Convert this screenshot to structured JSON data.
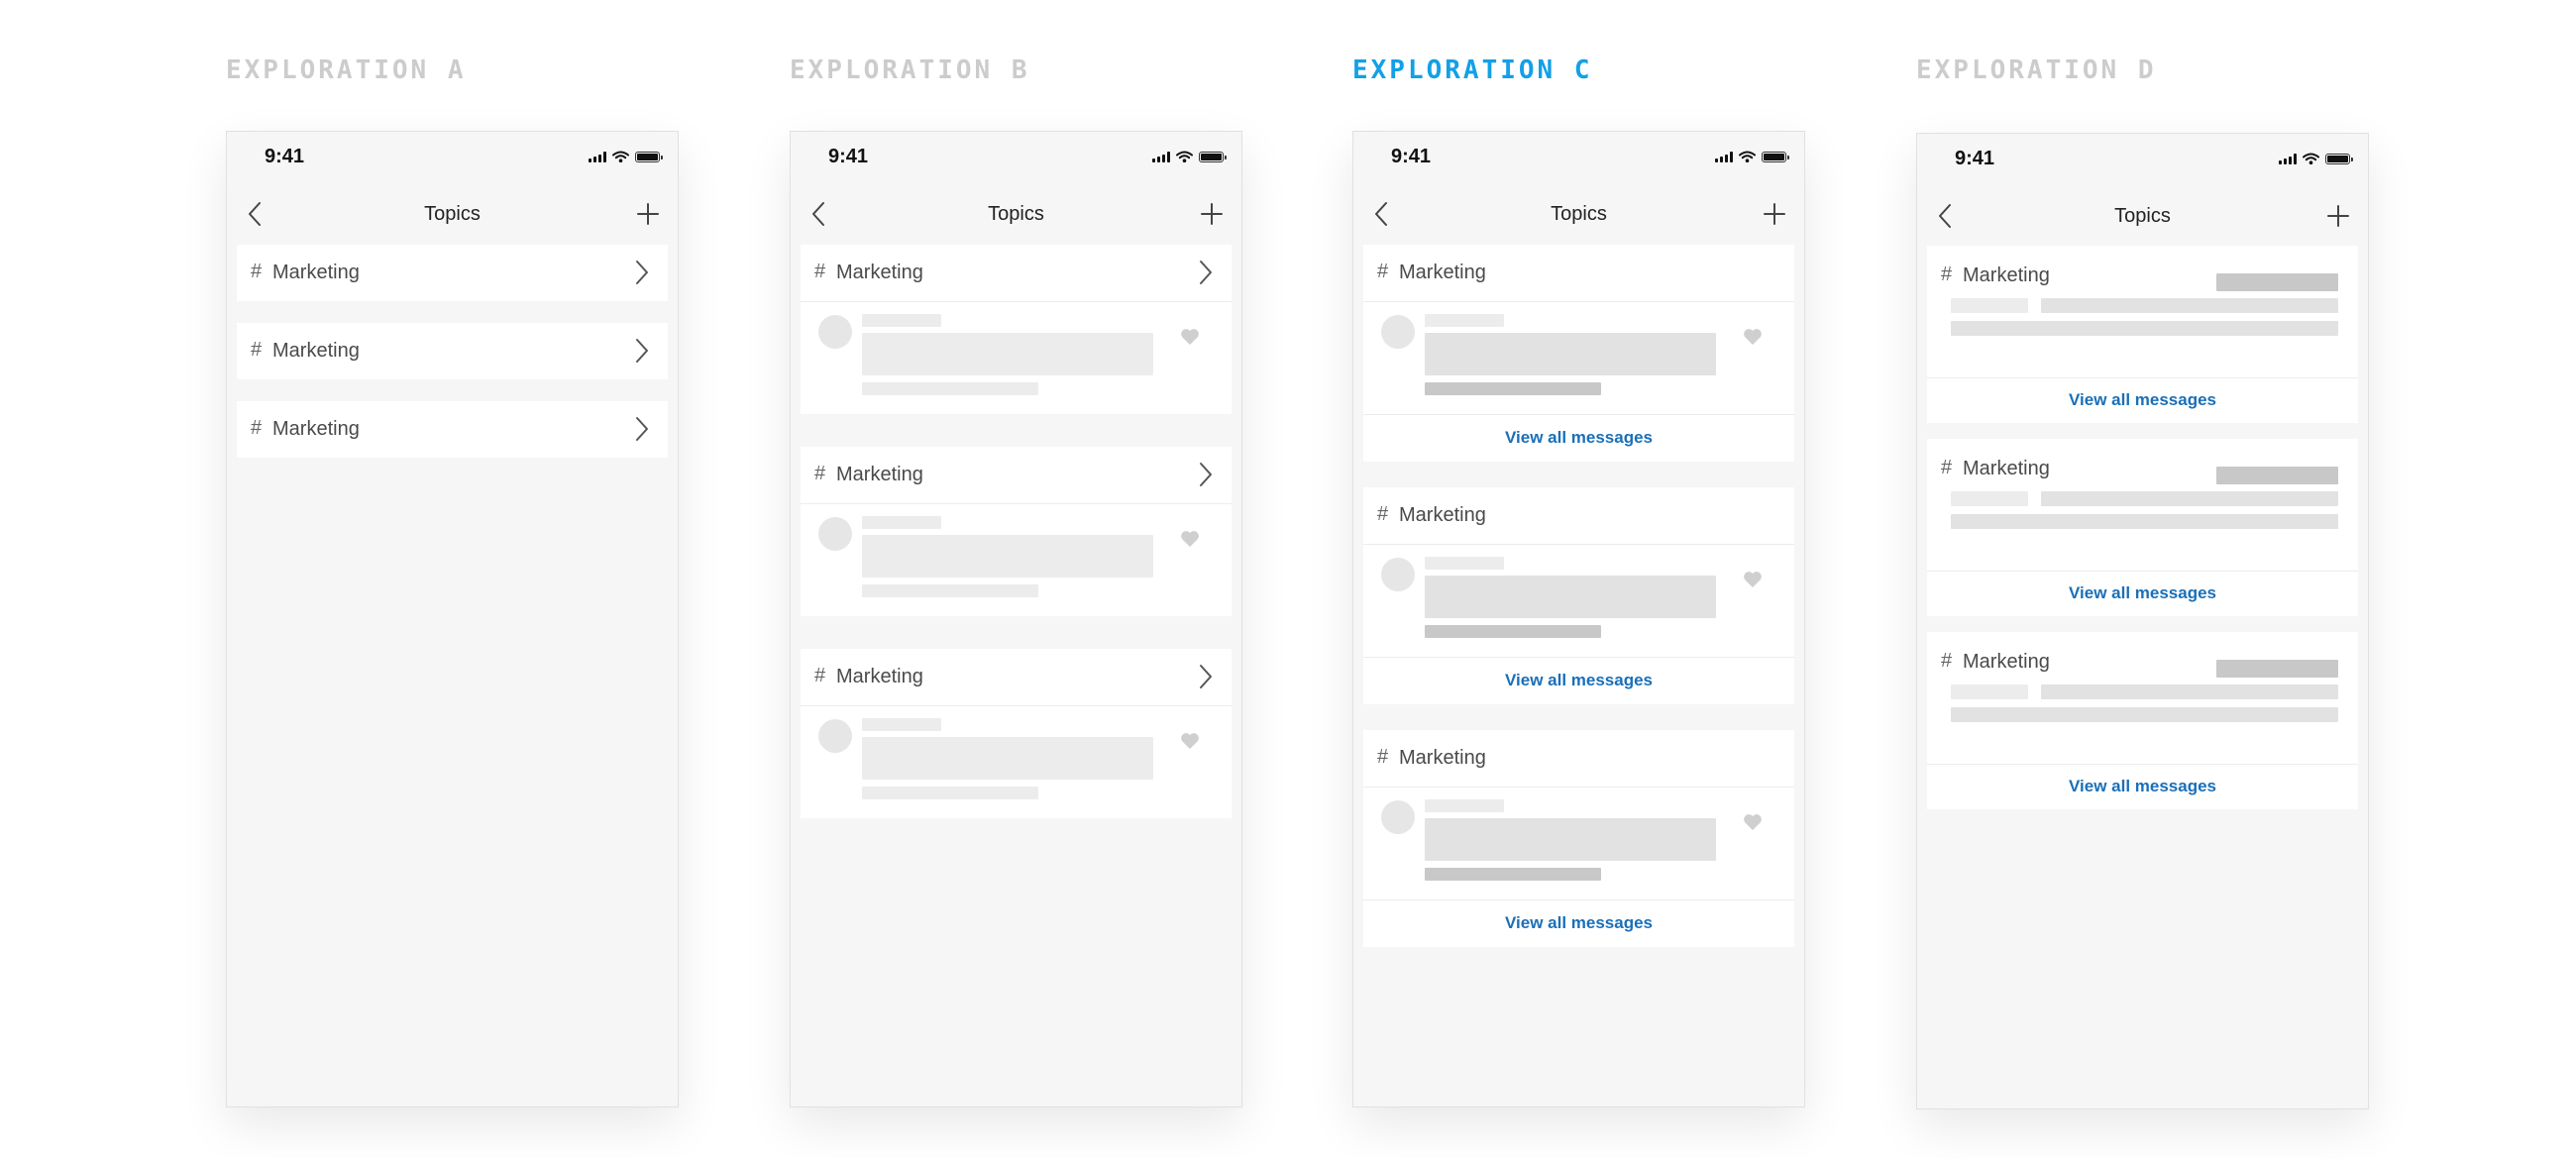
{
  "explorations": [
    {
      "title": "EXPLORATION A",
      "active": false,
      "status_time": "9:41",
      "nav_title": "Topics",
      "topics": [
        {
          "hash": "#",
          "label": "Marketing"
        },
        {
          "hash": "#",
          "label": "Marketing"
        },
        {
          "hash": "#",
          "label": "Marketing"
        }
      ]
    },
    {
      "title": "EXPLORATION B",
      "active": false,
      "status_time": "9:41",
      "nav_title": "Topics",
      "topics": [
        {
          "hash": "#",
          "label": "Marketing"
        },
        {
          "hash": "#",
          "label": "Marketing"
        },
        {
          "hash": "#",
          "label": "Marketing"
        }
      ]
    },
    {
      "title": "EXPLORATION C",
      "active": true,
      "status_time": "9:41",
      "nav_title": "Topics",
      "topics": [
        {
          "hash": "#",
          "label": "Marketing",
          "view_all": "View all messages"
        },
        {
          "hash": "#",
          "label": "Marketing",
          "view_all": "View all messages"
        },
        {
          "hash": "#",
          "label": "Marketing",
          "view_all": "View all messages"
        }
      ]
    },
    {
      "title": "EXPLORATION D",
      "active": false,
      "status_time": "9:41",
      "nav_title": "Topics",
      "topics": [
        {
          "hash": "#",
          "label": "Marketing",
          "view_all": "View all messages"
        },
        {
          "hash": "#",
          "label": "Marketing",
          "view_all": "View all messages"
        },
        {
          "hash": "#",
          "label": "Marketing",
          "view_all": "View all messages"
        }
      ]
    }
  ],
  "colors": {
    "accent": "#12a0e8",
    "inactive_title": "#cccccc",
    "link": "#1a6fb8",
    "phone_background": "#f6f6f6",
    "card": "#ffffff",
    "skeleton_light": "#ececec",
    "skeleton_mid": "#e2e2e2",
    "skeleton_dark": "#c8c8c8",
    "heart": "#cfcfcf"
  },
  "icons": [
    "cellular-signal-icon",
    "wifi-icon",
    "battery-icon",
    "back-chevron-icon",
    "plus-icon",
    "chevron-right-icon",
    "heart-icon",
    "avatar-placeholder"
  ]
}
